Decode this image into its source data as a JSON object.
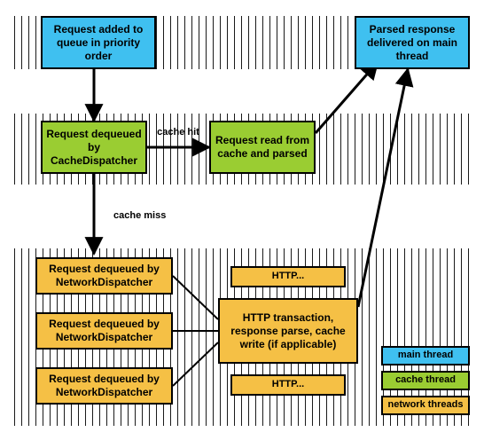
{
  "colors": {
    "main": "#3FC0F0",
    "cache": "#9ACD32",
    "network": "#F5C045"
  },
  "main_thread": {
    "request_added": "Request added to queue in priority order",
    "parsed_delivered": "Parsed response delivered on main thread"
  },
  "cache_thread": {
    "dequeued": "Request dequeued by CacheDispatcher",
    "cache_hit_label": "cache hit",
    "read_parsed": "Request read from cache and parsed"
  },
  "network_thread": {
    "cache_miss_label": "cache miss",
    "dequeued": "Request dequeued by NetworkDispatcher",
    "http_short": "HTTP...",
    "http_full": "HTTP transaction, response parse, cache write (if applicable)"
  },
  "legend": {
    "main": "main thread",
    "cache": "cache thread",
    "network": "network threads"
  }
}
